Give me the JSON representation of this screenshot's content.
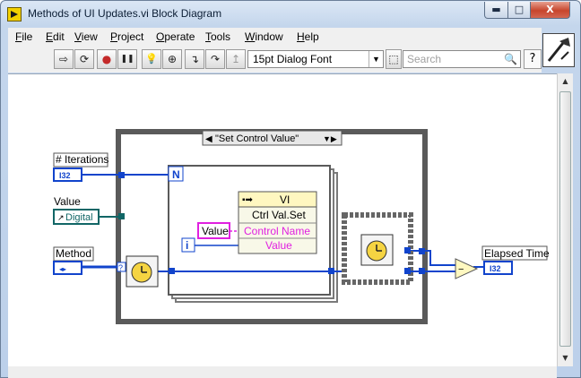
{
  "window": {
    "title": "Methods of UI Updates.vi Block Diagram",
    "min_glyph": "▬",
    "max_glyph": "□",
    "close_glyph": "X"
  },
  "menu": [
    {
      "u": "F",
      "rest": "ile"
    },
    {
      "u": "E",
      "rest": "dit"
    },
    {
      "u": "V",
      "rest": "iew"
    },
    {
      "u": "P",
      "rest": "roject"
    },
    {
      "u": "O",
      "rest": "perate"
    },
    {
      "u": "T",
      "rest": "ools"
    },
    {
      "u": "W",
      "rest": "indow"
    },
    {
      "u": "H",
      "rest": "elp"
    }
  ],
  "toolbar": {
    "run_glyph": "⇨",
    "run_continuous_glyph": "⟳",
    "abort_glyph": "●",
    "pause_glyph": "❚❚",
    "highlight_glyph": "💡",
    "retain_glyph": "⊕",
    "step_into_glyph": "↴",
    "step_over_glyph": "↷",
    "step_out_glyph": "↥",
    "font": "15pt Dialog Font",
    "font_arrow": "▼",
    "align_glyph": "⬚",
    "search_placeholder": "Search",
    "search_icon": "🔍",
    "help": "?"
  },
  "diagram": {
    "case_selector": "\"Set Control Value\"",
    "case_left": "◀",
    "case_right": "▼▶",
    "iterations_label": "# Iterations",
    "iterations_type": "I32",
    "value_label": "Value",
    "value_ref": "Digital",
    "method_label": "Method",
    "loop_count": "N",
    "loop_index": "i",
    "node_title": "VI",
    "node_method": "Ctrl Val.Set",
    "node_input_name": "Control Name",
    "node_input_value": "Value",
    "string_const": "Value",
    "tunnel_q": "?",
    "elapsed_label": "Elapsed Time",
    "elapsed_type": "I32",
    "subtract": "−"
  },
  "colors": {
    "wire_int": "#1144cc",
    "wire_string": "#e020e0",
    "wire_ref": "#116666",
    "wire_cluster": "#1144cc",
    "frame": "#5a5a5a"
  }
}
